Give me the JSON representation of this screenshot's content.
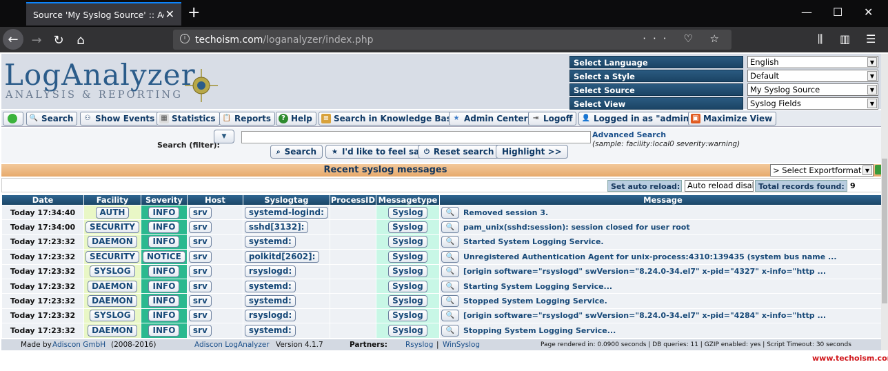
{
  "browser": {
    "tab_title": "Source 'My Syslog Source' :: Adiscon",
    "url_host": "techoism.com",
    "url_path": "/loganalyzer/index.php"
  },
  "logo": {
    "main": "LogAnalyzer",
    "sub": "ANALYSIS & REPORTING"
  },
  "selectors": [
    {
      "label": "Select Language",
      "value": "English"
    },
    {
      "label": "Select a Style",
      "value": "Default"
    },
    {
      "label": "Select Source",
      "value": "My Syslog Source"
    },
    {
      "label": "Select View",
      "value": "Syslog Fields"
    }
  ],
  "toolbar": {
    "search": "Search",
    "show_events": "Show Events",
    "statistics": "Statistics",
    "reports": "Reports",
    "help": "Help",
    "kb": "Search in Knowledge Base",
    "admin": "Admin Center",
    "logoff": "Logoff",
    "logged_in": "Logged in as \"admin\"",
    "maximize": "Maximize View"
  },
  "search": {
    "label": "Search (filter):",
    "advanced": "Advanced Search",
    "sample": "(sample: facility:local0 severity:warning)",
    "search_btn": "Search",
    "feel_sad_btn": "I'd like to feel sad",
    "reset_btn": "Reset search",
    "highlight_btn": "Highlight >>"
  },
  "messages_title": "Recent syslog messages",
  "export_select": "> Select Exportformat <",
  "reload": {
    "label": "Set auto reload:",
    "select": "Auto reload disabled",
    "total_label": "Total records found:",
    "total": "9"
  },
  "columns": [
    "Date",
    "Facility",
    "Severity",
    "Host",
    "Syslogtag",
    "ProcessID",
    "Messagetype",
    "Message"
  ],
  "rows": [
    {
      "date": "Today 17:34:40",
      "facility": "AUTH",
      "severity": "INFO",
      "host": "srv",
      "tag": "systemd-logind:",
      "pid": "",
      "type": "Syslog",
      "message": "Removed session 3."
    },
    {
      "date": "Today 17:34:00",
      "facility": "SECURITY",
      "severity": "INFO",
      "host": "srv",
      "tag": "sshd[3132]:",
      "pid": "",
      "type": "Syslog",
      "message": "pam_unix(sshd:session): session closed for user root"
    },
    {
      "date": "Today 17:23:32",
      "facility": "DAEMON",
      "severity": "INFO",
      "host": "srv",
      "tag": "systemd:",
      "pid": "",
      "type": "Syslog",
      "message": "Started System Logging Service."
    },
    {
      "date": "Today 17:23:32",
      "facility": "SECURITY",
      "severity": "NOTICE",
      "host": "srv",
      "tag": "polkitd[2602]:",
      "pid": "",
      "type": "Syslog",
      "message": "Unregistered Authentication Agent for unix-process:4310:139435 (system bus name ..."
    },
    {
      "date": "Today 17:23:32",
      "facility": "SYSLOG",
      "severity": "INFO",
      "host": "srv",
      "tag": "rsyslogd:",
      "pid": "",
      "type": "Syslog",
      "message": "[origin software=\"rsyslogd\" swVersion=\"8.24.0-34.el7\" x-pid=\"4327\" x-info=\"http ..."
    },
    {
      "date": "Today 17:23:32",
      "facility": "DAEMON",
      "severity": "INFO",
      "host": "srv",
      "tag": "systemd:",
      "pid": "",
      "type": "Syslog",
      "message": "Starting System Logging Service..."
    },
    {
      "date": "Today 17:23:32",
      "facility": "DAEMON",
      "severity": "INFO",
      "host": "srv",
      "tag": "systemd:",
      "pid": "",
      "type": "Syslog",
      "message": "Stopped System Logging Service."
    },
    {
      "date": "Today 17:23:32",
      "facility": "SYSLOG",
      "severity": "INFO",
      "host": "srv",
      "tag": "rsyslogd:",
      "pid": "",
      "type": "Syslog",
      "message": "[origin software=\"rsyslogd\" swVersion=\"8.24.0-34.el7\" x-pid=\"4284\" x-info=\"http ..."
    },
    {
      "date": "Today 17:23:32",
      "facility": "DAEMON",
      "severity": "INFO",
      "host": "srv",
      "tag": "systemd:",
      "pid": "",
      "type": "Syslog",
      "message": "Stopping System Logging Service..."
    }
  ],
  "footer": {
    "made_by": "Made by",
    "company": "Adiscon GmbH",
    "years": "(2008-2016)",
    "product": "Adiscon LogAnalyzer",
    "version": "Version 4.1.7",
    "partners": "Partners:",
    "rsyslog": "Rsyslog",
    "winsyslog": "WinSyslog",
    "stats": "Page rendered in: 0.0900 seconds | DB queries: 11 | GZIP enabled: yes | Script Timeout: 30 seconds"
  },
  "watermark": "www.techoism.com"
}
